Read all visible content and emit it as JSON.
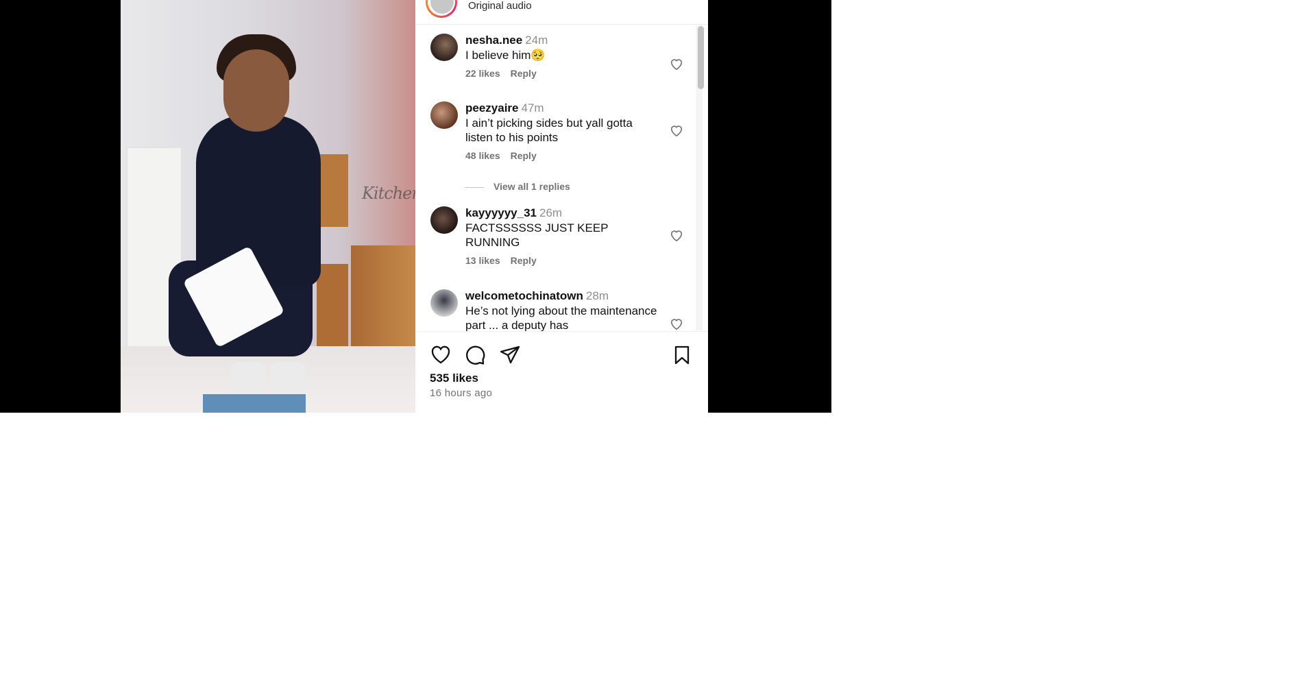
{
  "post": {
    "audio_label": "Original audio",
    "likes": "535 likes",
    "time_ago": "16 hours ago"
  },
  "comments": [
    {
      "user": "nesha.nee",
      "time": "24m",
      "text": "I believe him🥺",
      "likes": "22 likes",
      "reply": "Reply"
    },
    {
      "user": "peezyaire",
      "time": "47m",
      "text": "I ain’t picking sides but yall gotta listen to his points",
      "likes": "48 likes",
      "reply": "Reply",
      "view_replies": "View all 1 replies"
    },
    {
      "user": "kayyyyyy_31",
      "time": "26m",
      "text": "FACTSSSSSS JUST KEEP RUNNING",
      "likes": "13 likes",
      "reply": "Reply"
    },
    {
      "user": "welcometochinatown",
      "time": "28m",
      "text": "He’s not lying about the maintenance part ... a deputy has"
    }
  ],
  "icons": {
    "like": "heart-icon",
    "comment": "comment-icon",
    "share": "paper-plane-icon",
    "save": "bookmark-icon"
  },
  "colors": {
    "panel_background": "#ffffff",
    "page_background": "#000000",
    "muted_text": "#737373",
    "story_ring": "#e02a6c"
  }
}
